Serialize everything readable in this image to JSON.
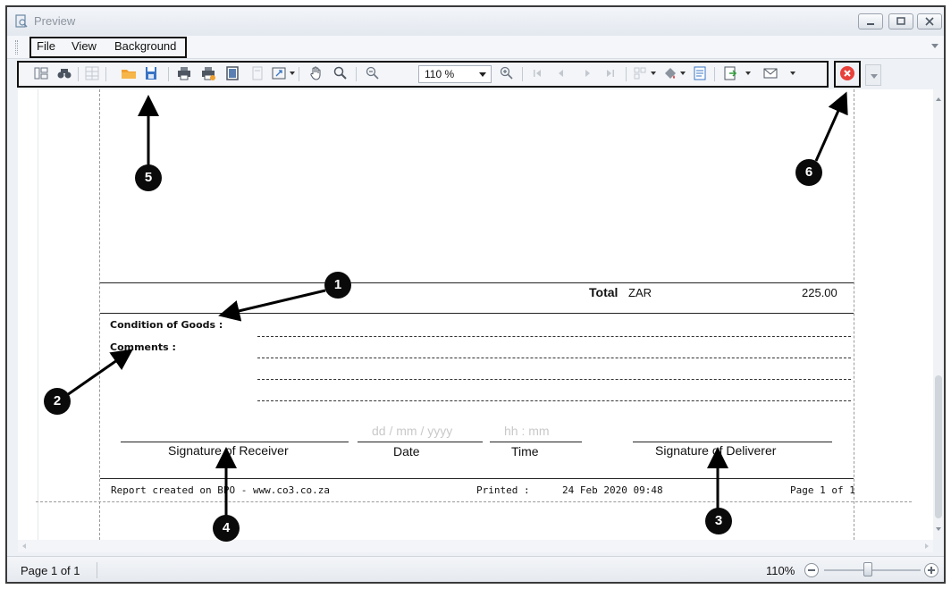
{
  "window": {
    "title": "Preview"
  },
  "menu": {
    "items": [
      "File",
      "View",
      "Background"
    ]
  },
  "toolbar": {
    "zoom_value": "110 %",
    "icons": [
      "document-map-icon",
      "search-icon",
      "thumbnails-icon",
      "open-icon",
      "save-icon",
      "print-icon",
      "quick-print-icon",
      "page-setup-icon",
      "header-footer-icon",
      "scale-icon",
      "hand-tool-icon",
      "magnifier-icon",
      "zoom-out-icon",
      "zoom-in-icon",
      "first-page-icon",
      "previous-page-icon",
      "next-page-icon",
      "last-page-icon",
      "multiple-pages-icon",
      "fill-background-icon",
      "watermark-icon",
      "export-icon",
      "send-email-icon",
      "close-preview-icon"
    ],
    "close_color": "#e8403a"
  },
  "report": {
    "total_label": "Total",
    "total_currency": "ZAR",
    "total_amount": "225.00",
    "condition_label": "Condition of Goods :",
    "comments_label": "Comments :",
    "date_placeholder": "dd / mm / yyyy",
    "time_placeholder": "hh : mm",
    "sig_receiver": "Signature of Receiver",
    "sig_date": "Date",
    "sig_time": "Time",
    "sig_deliverer": "Signature of Deliverer",
    "footer_created": "Report created on BPO - www.co3.co.za",
    "footer_printed_label": "Printed :",
    "footer_printed_value": "24 Feb 2020 09:48",
    "footer_page": "Page 1 of 1"
  },
  "status": {
    "page": "Page 1 of 1",
    "zoom": "110%",
    "zoom_slider_fraction": 0.45
  },
  "annotations": [
    "1",
    "2",
    "3",
    "4",
    "5",
    "6"
  ]
}
